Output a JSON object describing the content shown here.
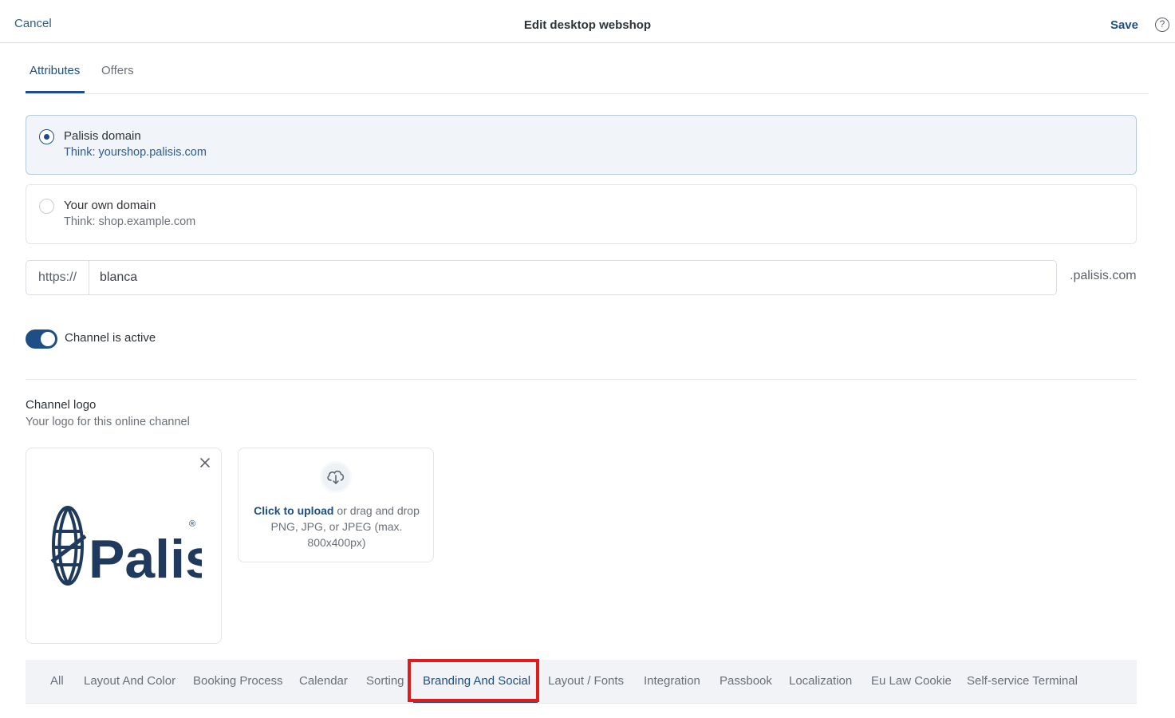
{
  "header": {
    "cancel_label": "Cancel",
    "title": "Edit desktop webshop",
    "save_label": "Save",
    "help_symbol": "?"
  },
  "tabs": [
    {
      "label": "Attributes",
      "active": true
    },
    {
      "label": "Offers",
      "active": false
    }
  ],
  "domain_options": [
    {
      "title": "Palisis domain",
      "subtitle": "Think: yourshop.palisis.com",
      "selected": true
    },
    {
      "title": "Your own domain",
      "subtitle": "Think: shop.example.com",
      "selected": false
    }
  ],
  "url": {
    "prefix": "https://",
    "value": "blanca",
    "suffix": ".palisis.com"
  },
  "channel_toggle": {
    "label": "Channel is active",
    "on": true
  },
  "logo_section": {
    "title": "Channel logo",
    "subtitle": "Your logo for this online channel",
    "logo_text": "Palisis",
    "logo_mark": "®"
  },
  "upload": {
    "link_text": "Click to upload",
    "rest_text": " or drag and drop PNG, JPG, or JPEG (max. 800x400px)"
  },
  "categories": [
    {
      "label": "All",
      "active": false
    },
    {
      "label": "Layout And Color",
      "active": false
    },
    {
      "label": "Booking Process",
      "active": false
    },
    {
      "label": "Calendar",
      "active": false
    },
    {
      "label": "Sorting",
      "active": false
    },
    {
      "label": "Branding And Social",
      "active": true
    },
    {
      "label": "Layout / Fonts",
      "active": false
    },
    {
      "label": "Integration",
      "active": false
    },
    {
      "label": "Passbook",
      "active": false
    },
    {
      "label": "Localization",
      "active": false
    },
    {
      "label": "Eu Law Cookie",
      "active": false
    },
    {
      "label": "Self-service Terminal",
      "active": false
    }
  ],
  "colors": {
    "accent": "#1d4f86",
    "highlight": "#e01b1b",
    "logo_navy": "#1f3a5c"
  },
  "icons": [
    "help-icon",
    "close-icon",
    "cloud-upload-icon",
    "globe-logo-icon"
  ]
}
